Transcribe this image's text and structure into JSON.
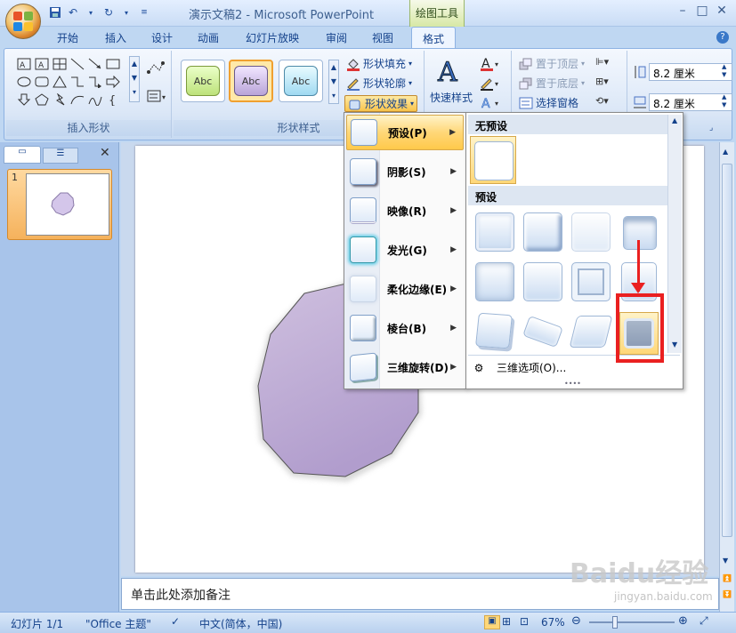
{
  "app": {
    "title": "演示文稿2 - Microsoft PowerPoint",
    "contextual_tab": "绘图工具"
  },
  "tabs": [
    "开始",
    "插入",
    "设计",
    "动画",
    "幻灯片放映",
    "审阅",
    "视图",
    "格式"
  ],
  "active_tab": "格式",
  "ribbon": {
    "insert_shapes_label": "插入形状",
    "shape_styles_label": "形状样式",
    "style_boxes": [
      "Abc",
      "Abc",
      "Abc"
    ],
    "fill_label": "形状填充",
    "outline_label": "形状轮廓",
    "effects_label": "形状效果",
    "quick_styles_label": "快速样式",
    "bring_front_label": "置于顶层",
    "send_back_label": "置于底层",
    "selection_pane_label": "选择窗格",
    "height_value": "8.2 厘米",
    "width_value": "8.2 厘米"
  },
  "effects_menu": {
    "items": [
      "预设(P)",
      "阴影(S)",
      "映像(R)",
      "发光(G)",
      "柔化边缘(E)",
      "棱台(B)",
      "三维旋转(D)"
    ],
    "selected": "预设(P)"
  },
  "preset_submenu": {
    "no_preset_header": "无预设",
    "preset_header": "预设",
    "footer_label": "三维选项(O)..."
  },
  "slides_panel": {
    "slide_number": "1"
  },
  "notes": {
    "placeholder": "单击此处添加备注"
  },
  "status": {
    "slide_info": "幻灯片 1/1",
    "theme": "\"Office 主题\"",
    "language": "中文(简体，中国)",
    "zoom": "67%"
  },
  "watermark": {
    "main": "Baidu经验",
    "sub": "jingyan.baidu.com"
  },
  "colors": {
    "accent": "#15428b",
    "highlight": "#ffc94a",
    "shape_fill": "#b7a5d3",
    "annotation_red": "#ea2020"
  }
}
